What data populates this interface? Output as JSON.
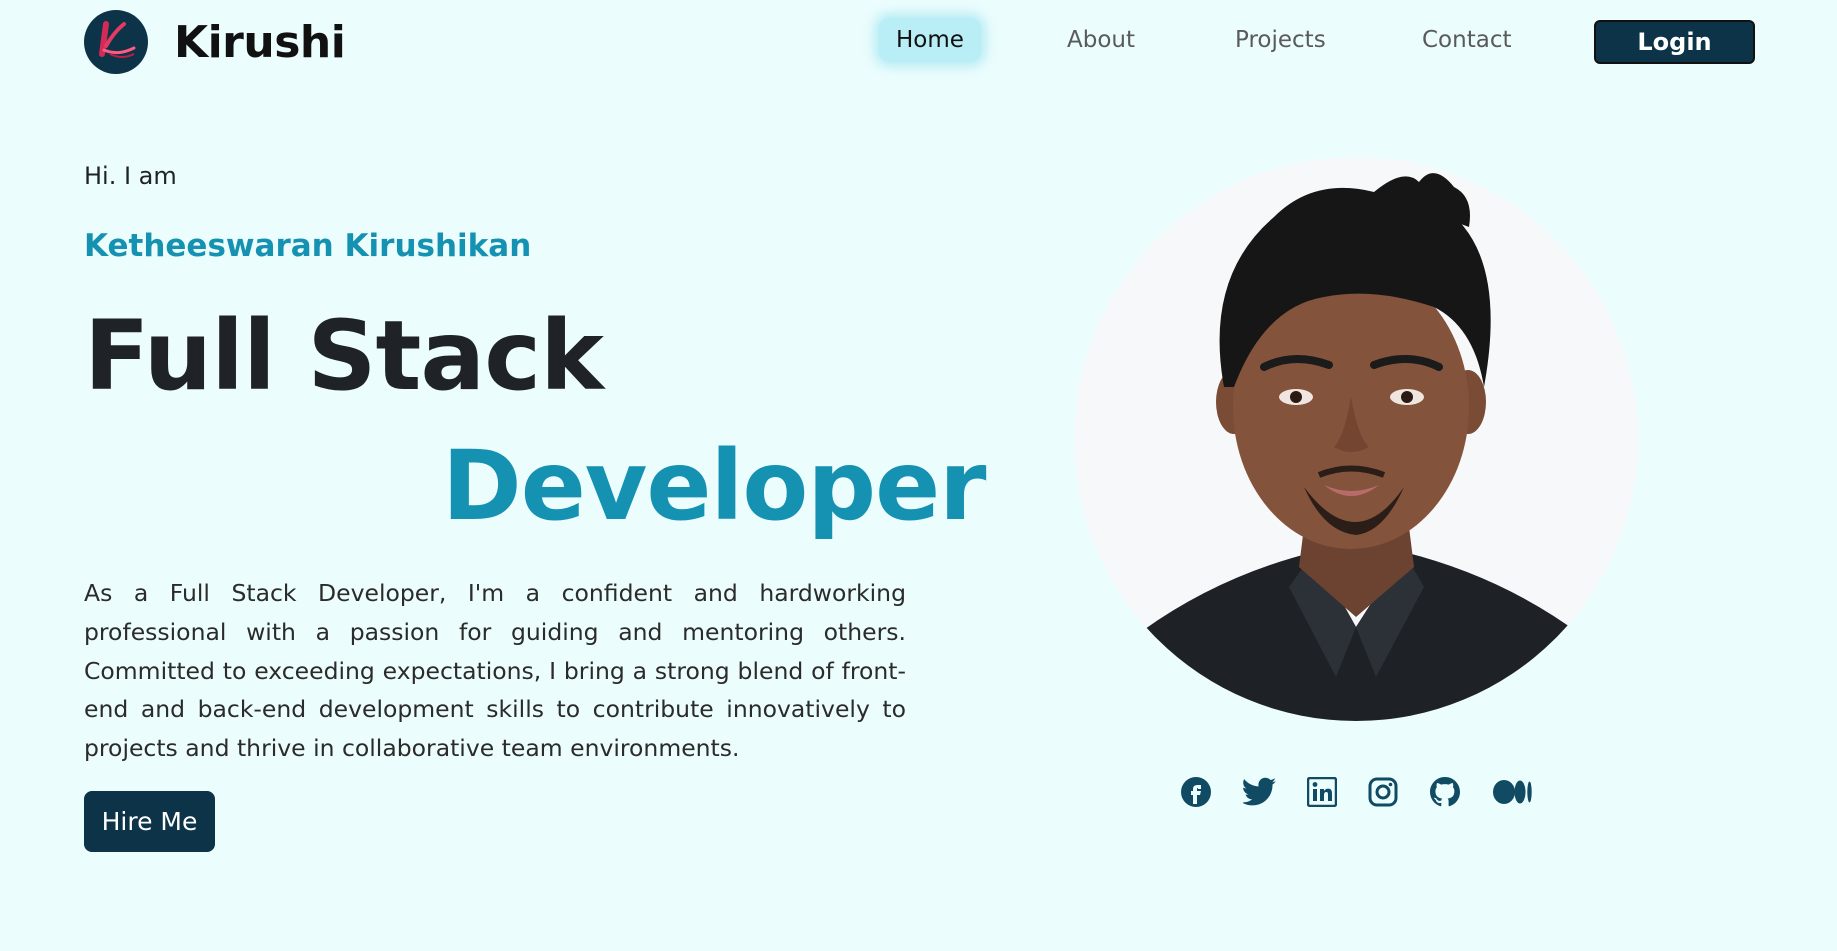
{
  "navbar": {
    "brand": "Kirushi",
    "links": [
      {
        "label": "Home",
        "active": true
      },
      {
        "label": "About",
        "active": false
      },
      {
        "label": "Projects",
        "active": false
      },
      {
        "label": "Contact",
        "active": false
      }
    ],
    "login_label": "Login"
  },
  "hero": {
    "greeting": "Hi. I am",
    "name": "Ketheeswaran Kirushikan",
    "title_line1": "Full Stack",
    "title_line2": "Developer",
    "bio": "As a Full Stack Developer, I'm a confident and hardworking professional with a passion for guiding and mentoring others. Committed to exceeding expectations, I bring a strong blend of front-end and back-end development skills to contribute innovatively to projects and thrive in collaborative team environments.",
    "hire_label": "Hire Me"
  },
  "social": [
    "facebook-icon",
    "twitter-icon",
    "linkedin-icon",
    "instagram-icon",
    "github-icon",
    "medium-icon"
  ],
  "colors": {
    "background": "#ecfdfd",
    "accent": "#1591b2",
    "dark": "#0c3347",
    "active_nav": "#b9eef6"
  }
}
